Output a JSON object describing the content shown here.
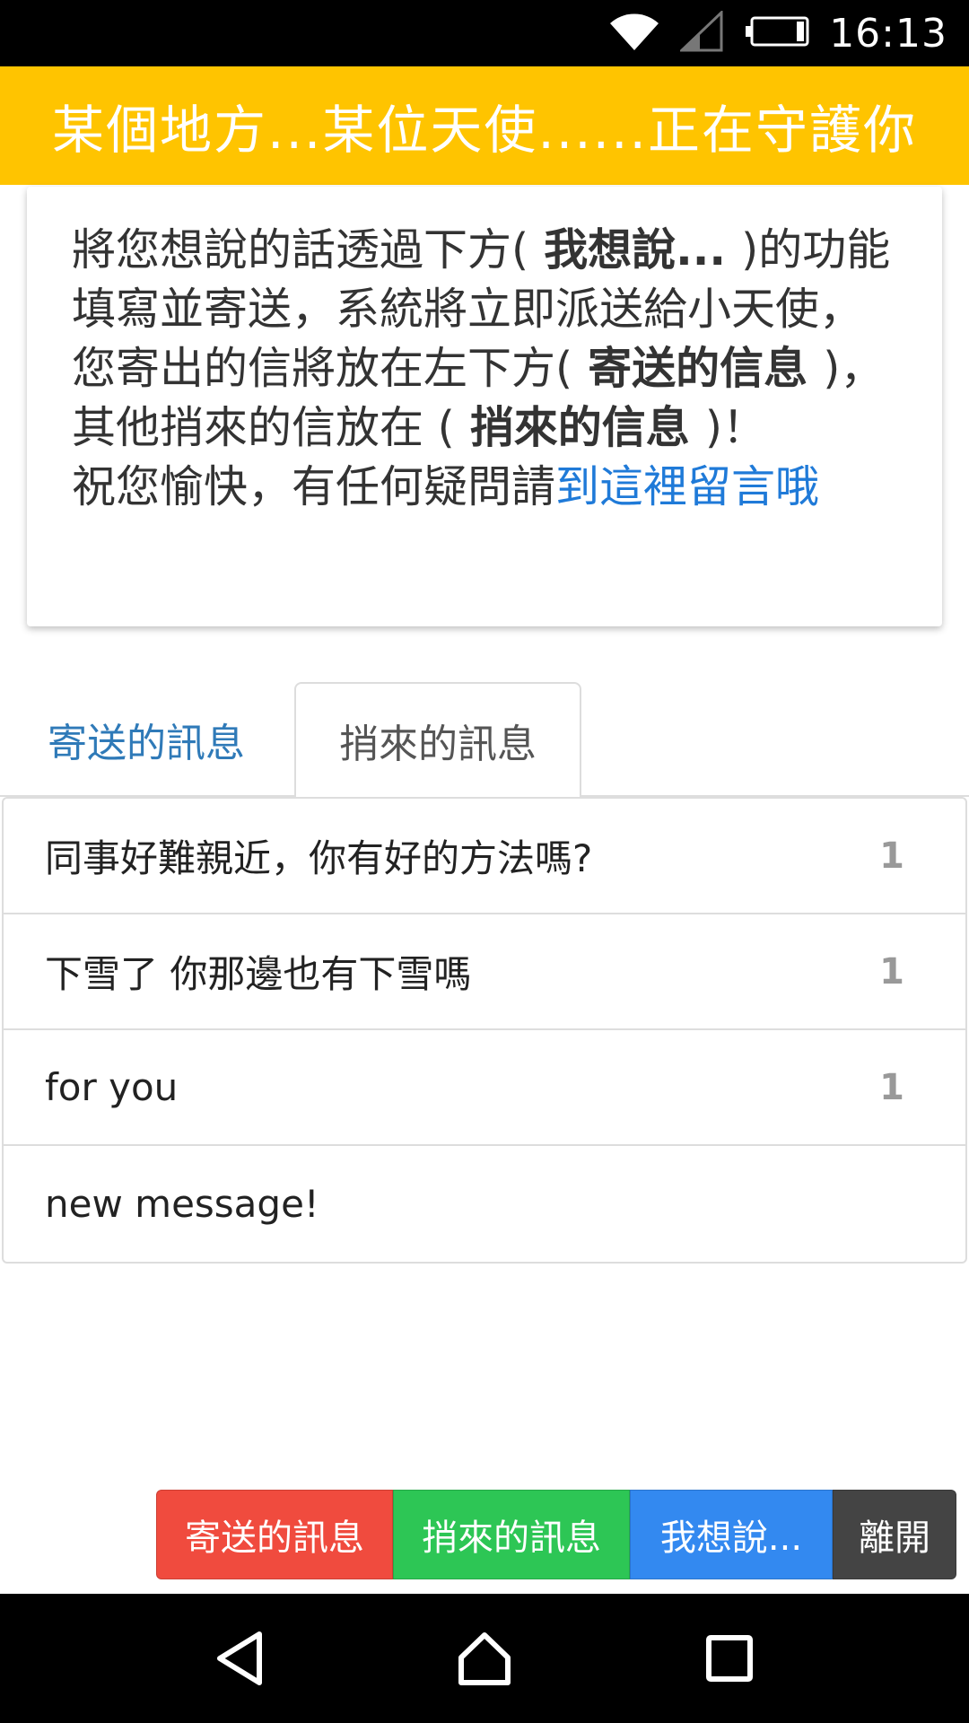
{
  "status_bar": {
    "time": "16:13"
  },
  "header": {
    "title": "某個地方...某位天使......正在守護你"
  },
  "intro": {
    "line1_prefix": "將您想說的話透過下方(",
    "line1_bold": " 我想說... ",
    "line1_suffix": ")的功能填寫並寄送，系統將立即派送給小天使，",
    "line2_prefix": "您寄出的信將放在左下方(",
    "line2_bold": " 寄送的信息 ",
    "line2_mid": ")，其他捎來的信放在 (",
    "line2_bold2": " 捎來的信息 ",
    "line2_suffix": ")！",
    "line3_prefix": "祝您愉快，有任何疑問請",
    "link_text": "到這裡留言哦"
  },
  "tabs": {
    "sent": "寄送的訊息",
    "received": "捎來的訊息"
  },
  "messages": [
    {
      "title": "同事好難親近，你有好的方法嗎?",
      "count": "1"
    },
    {
      "title": "下雪了 你那邊也有下雪嗎",
      "count": "1"
    },
    {
      "title": "for you",
      "count": "1"
    },
    {
      "title": "new message!",
      "count": ""
    }
  ],
  "buttons": {
    "sent": "寄送的訊息",
    "received": "捎來的訊息",
    "say": "我想說...",
    "leave": "離開"
  },
  "colors": {
    "header": "#ffc400",
    "link": "#1f7ad8",
    "btn_sent": "#f04b3e",
    "btn_received": "#2dc655",
    "btn_say": "#3389f0",
    "btn_leave": "#444444"
  }
}
